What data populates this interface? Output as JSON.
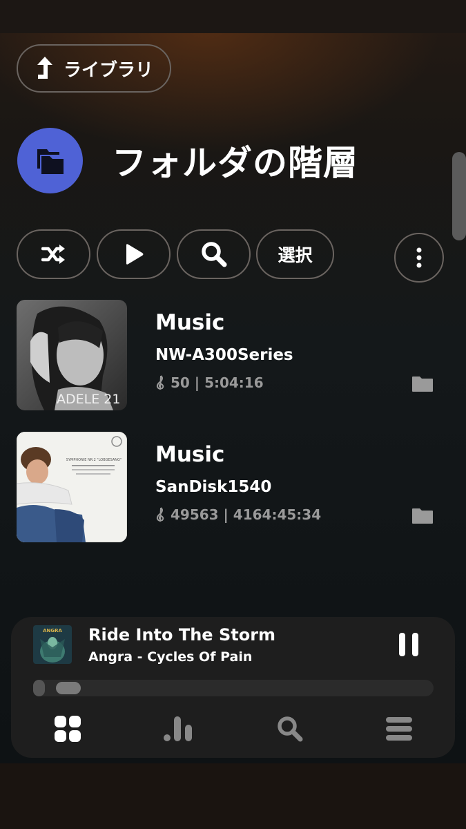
{
  "header": {
    "back_label": "ライブラリ",
    "title": "フォルダの階層"
  },
  "toolbar": {
    "shuffle_icon": "shuffle-icon",
    "play_icon": "play-icon",
    "search_icon": "search-icon",
    "select_label": "選択",
    "more_icon": "more-vertical-icon"
  },
  "folders": [
    {
      "name": "Music",
      "device": "NW-A300Series",
      "stats": "50 | 5:04:16",
      "art_text": "ADELE 21"
    },
    {
      "name": "Music",
      "device": "SanDisk1540",
      "stats": "49563 | 4164:45:34",
      "art_text": "SYMPHONIE NR.2 \"LOBGESANG\""
    }
  ],
  "now_playing": {
    "track": "Ride Into The Storm",
    "artist_album": "Angra - Cycles Of Pain",
    "art_text": "ANGRA",
    "progress_fraction": 0.03
  },
  "bottom_nav": [
    "library-icon",
    "stats-icon",
    "search-icon",
    "menu-icon"
  ],
  "colors": {
    "accent": "#4f62d6",
    "muted_text": "#9a9a9a"
  }
}
